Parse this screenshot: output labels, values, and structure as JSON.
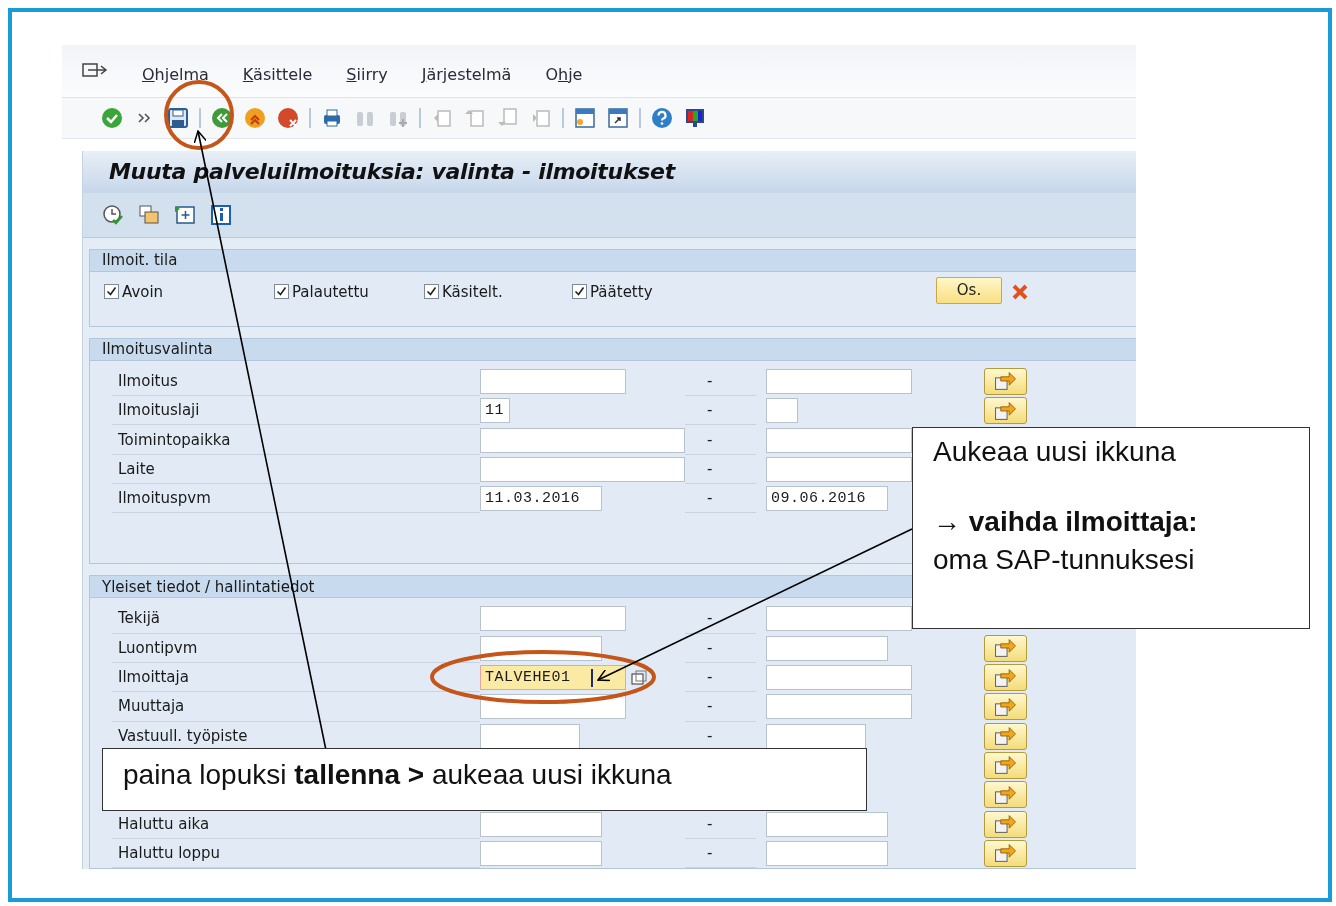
{
  "menu": [
    {
      "key": "O",
      "post": "hjelma"
    },
    {
      "key": "K",
      "post": "äsittele"
    },
    {
      "key": "S",
      "post": "iirry"
    },
    {
      "key": "J",
      "post": "ärjestelmä"
    },
    {
      "pre": "O",
      "key": "h",
      "post": "je"
    }
  ],
  "screen_title": "Muuta palveluilmoituksia: valinta - ilmoitukset",
  "status_group": {
    "title": "Ilmoit. tila",
    "checkboxes": [
      {
        "label": "Avoin",
        "checked": true
      },
      {
        "label": "Palautettu",
        "checked": true
      },
      {
        "label": "Käsitelt.",
        "checked": true
      },
      {
        "label": "Päätetty",
        "checked": true
      }
    ],
    "button": "Os."
  },
  "groups": [
    {
      "title": "Ilmoitusvalinta",
      "rows": [
        {
          "label": "Ilmoitus",
          "from": "",
          "separator": "-",
          "to": "",
          "multi": true
        },
        {
          "label": "Ilmoituslaji",
          "from": "11",
          "separator": "-",
          "to": "",
          "multi": true
        },
        {
          "label": "Toimintopaikka",
          "from": "",
          "separator": "-",
          "to": "",
          "multi": false
        },
        {
          "label": "Laite",
          "from": "",
          "separator": "-",
          "to": "",
          "multi": false
        },
        {
          "label": "Ilmoituspvm",
          "from": "11.03.2016",
          "separator": "-",
          "to": "09.06.2016",
          "multi": false
        }
      ]
    },
    {
      "title": "Yleiset tiedot / hallintatiedot",
      "rows": [
        {
          "label": "Tekijä",
          "from": "",
          "separator": "-",
          "to": "",
          "multi": false,
          "focused": false
        },
        {
          "label": "Luontipvm",
          "from": "",
          "separator": "-",
          "to": "",
          "multi": true,
          "focused": false
        },
        {
          "label": "Ilmoittaja",
          "from": "TALVEHE01",
          "separator": "-",
          "to": "",
          "multi": true,
          "focused": true
        },
        {
          "label": "Muuttaja",
          "from": "",
          "separator": "-",
          "to": "",
          "multi": true,
          "focused": false
        },
        {
          "label": "Vastuull. työpiste",
          "from": "",
          "separator": "-",
          "to": "",
          "multi": true,
          "focused": false
        },
        {
          "multi": true
        },
        {
          "multi": true
        },
        {
          "label": "Haluttu aika",
          "from": "",
          "separator": "-",
          "to": "",
          "multi": true,
          "focused": false
        },
        {
          "label": "Haluttu loppu",
          "from": "",
          "separator": "-",
          "to": "",
          "multi": true,
          "focused": false
        }
      ]
    }
  ],
  "callouts": [
    {
      "lines": [
        "Aukeaa uusi ikkuna",
        "→ **vaihda ilmoittaja:**",
        "oma SAP-tunnuksesi"
      ]
    },
    {
      "lines": [
        "paina lopuksi **tallenna >** aukeaa uusi ikkuna"
      ]
    }
  ]
}
